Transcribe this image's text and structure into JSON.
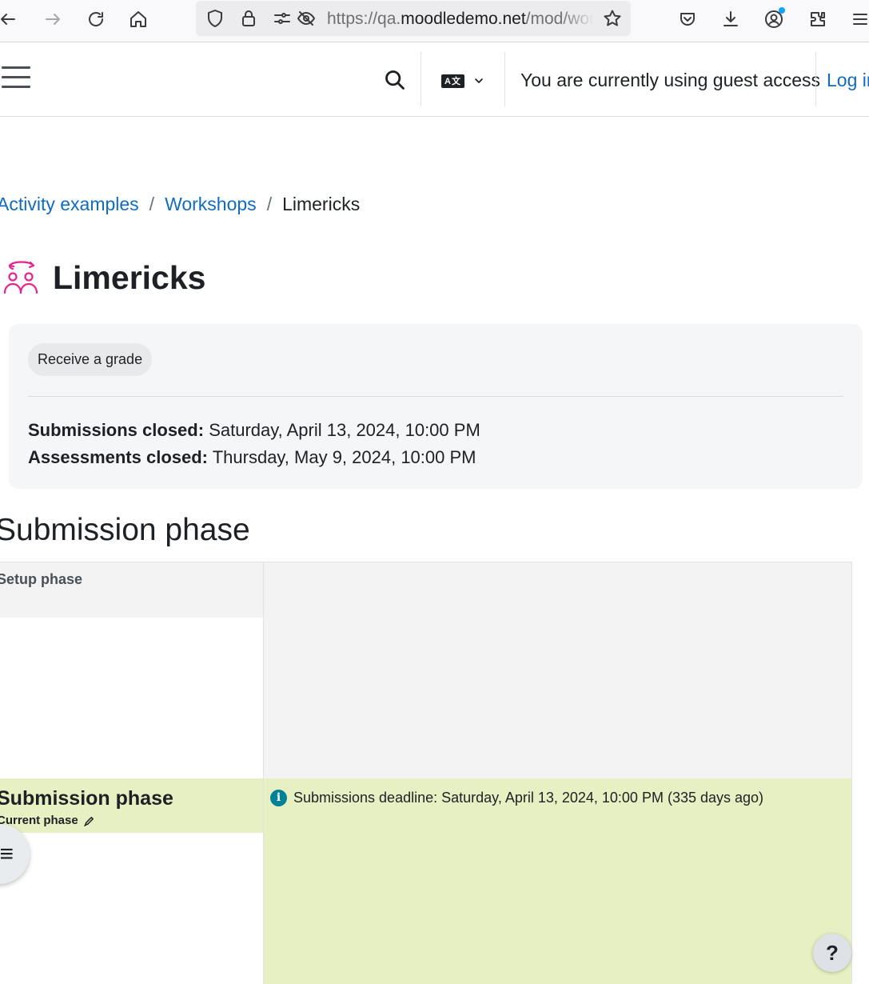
{
  "browser": {
    "url_prefix": "https://qa.",
    "url_domain": "moodledemo.net",
    "url_rest": "/mod/workshop/view.php?id=..."
  },
  "navbar": {
    "guest_text": "You are currently using guest access",
    "login_label": "Log in"
  },
  "breadcrumb": {
    "items": [
      "Activity examples",
      "Workshops",
      "Limericks"
    ],
    "separator": "/"
  },
  "page": {
    "title": "Limericks",
    "icon": "workshop-icon"
  },
  "info_card": {
    "pill_label": "Receive a grade",
    "submissions_label": "Submissions closed:",
    "submissions_value": "Saturday, April 13, 2024, 10:00 PM",
    "assessments_label": "Assessments closed:",
    "assessments_value": "Thursday, May 9, 2024, 10:00 PM"
  },
  "section": {
    "heading": "Submission phase"
  },
  "phases": {
    "setup_title": "Setup phase",
    "submission_title": "Submission phase",
    "current_phase_label": "Current phase",
    "deadline_text": "Submissions deadline: Saturday, April 13, 2024, 10:00 PM (335 days ago)"
  },
  "floating": {
    "drawer_icon": "≡",
    "help_label": "?"
  },
  "colors": {
    "link": "#0f6cbf",
    "accent_pink": "#e8248c",
    "current_phase_bg": "#e6f0c2",
    "info_teal": "#008196"
  }
}
